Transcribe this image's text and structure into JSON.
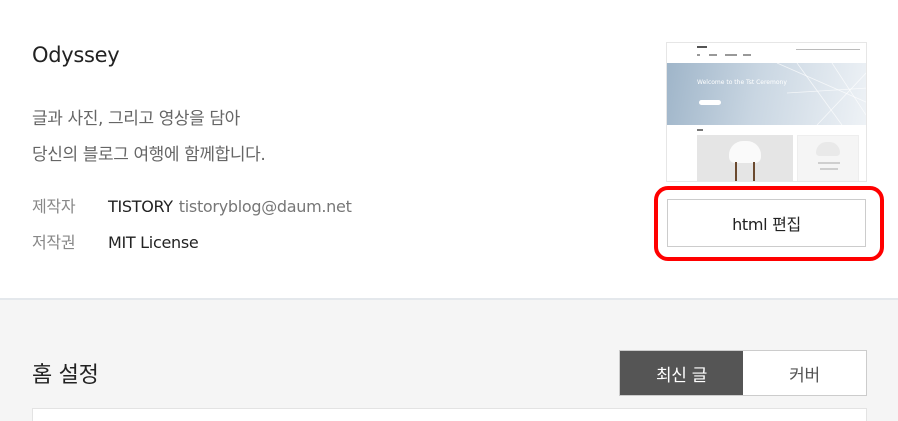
{
  "skin": {
    "name": "Odyssey",
    "description": [
      "글과 사진, 그리고 영상을 담아",
      "당신의 블로그 여행에 함께합니다."
    ],
    "maker_label": "제작자",
    "maker_name": "TISTORY",
    "maker_email": "tistoryblog@daum.net",
    "license_label": "저작권",
    "license_value": "MIT License",
    "thumbnail_hero_text": "Welcome to the Tst Ceremony",
    "edit_button_label": "html 편집"
  },
  "home_settings": {
    "title": "홈 설정",
    "options": [
      {
        "label": "최신 글",
        "active": true
      },
      {
        "label": "커버",
        "active": false
      }
    ]
  },
  "colors": {
    "highlight": "#ff0000",
    "active_segment": "#555555",
    "panel_background": "#f5f5f5"
  }
}
